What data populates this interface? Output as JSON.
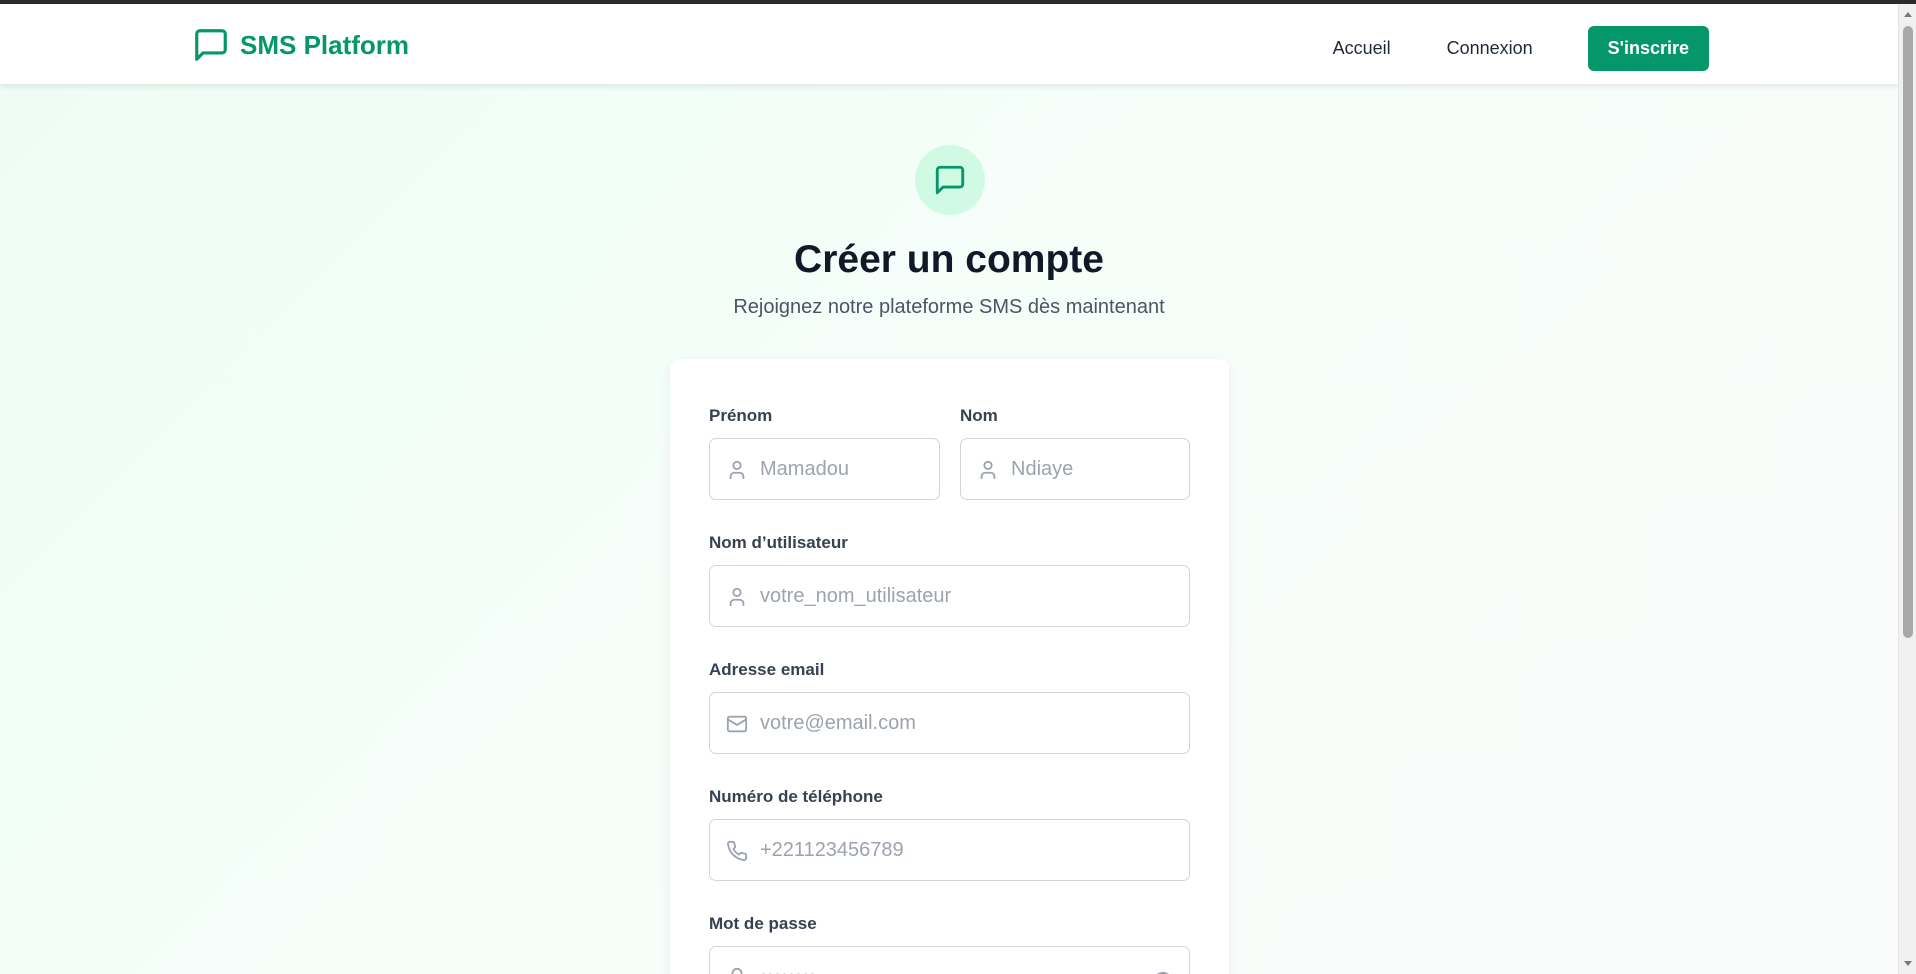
{
  "header": {
    "brand": "SMS Platform",
    "nav": {
      "home": "Accueil",
      "login": "Connexion",
      "signup": "S'inscrire"
    }
  },
  "hero": {
    "title": "Créer un compte",
    "subtitle": "Rejoignez notre plateforme SMS dès maintenant"
  },
  "form": {
    "first_name": {
      "label": "Prénom",
      "placeholder": "Mamadou",
      "icon": "user-icon"
    },
    "last_name": {
      "label": "Nom",
      "placeholder": "Ndiaye",
      "icon": "user-icon"
    },
    "username": {
      "label": "Nom d’utilisateur",
      "placeholder": "votre_nom_utilisateur",
      "icon": "user-icon"
    },
    "email": {
      "label": "Adresse email",
      "placeholder": "votre@email.com",
      "icon": "mail-icon"
    },
    "phone": {
      "label": "Numéro de téléphone",
      "placeholder": "+221123456789",
      "icon": "phone-icon"
    },
    "password": {
      "label": "Mot de passe",
      "placeholder": "••••••••",
      "icon": "lock-icon"
    }
  },
  "colors": {
    "brand": "#059669",
    "brand_light": "#d1fae5",
    "title": "#111827",
    "placeholder": "#9ca3af"
  }
}
